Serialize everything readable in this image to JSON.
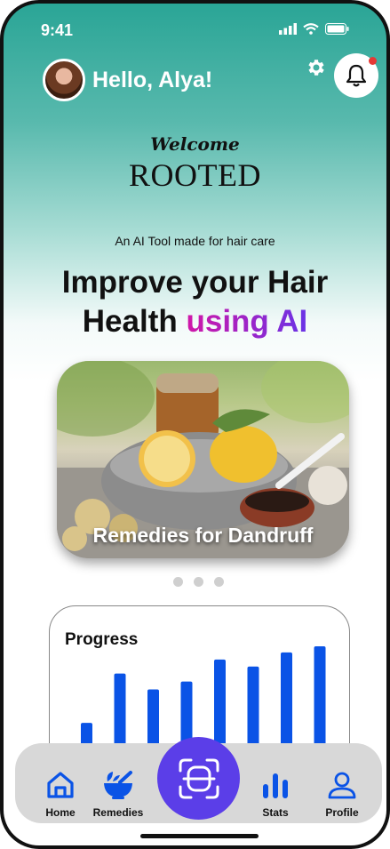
{
  "status": {
    "time": "9:41"
  },
  "header": {
    "greeting": "Hello, Alya!"
  },
  "brand": {
    "welcome": "Welcome",
    "name": "ROOTED"
  },
  "hero": {
    "tagline": "An AI Tool made for hair care",
    "headline_line1": "Improve your Hair",
    "headline_line2_plain": "Health ",
    "headline_line2_accent": "using AI"
  },
  "carousel": {
    "card_title": "Remedies for Dandruff",
    "dot_count": 3
  },
  "progress": {
    "title": "Progress"
  },
  "chart_data": {
    "type": "bar",
    "values": [
      12,
      68,
      50,
      59,
      84,
      76,
      92,
      99
    ],
    "ylim": [
      0,
      100
    ],
    "color": "#0a53e6"
  },
  "nav": {
    "home": "Home",
    "remedies": "Remedies",
    "stats": "Stats",
    "profile": "Profile"
  },
  "colors": {
    "accent": "#5b3ee8",
    "nav_blue": "#0a53e6",
    "teal": "#2aa596"
  }
}
